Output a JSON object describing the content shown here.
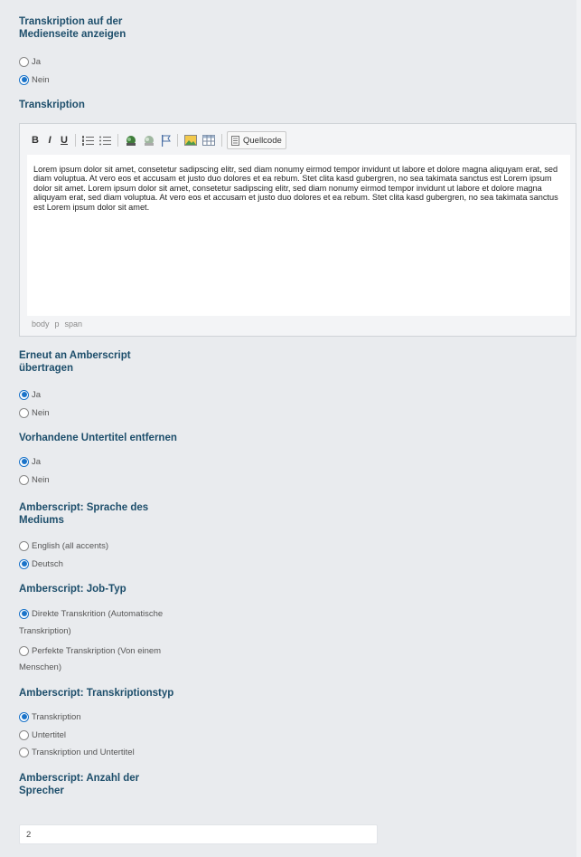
{
  "transcription_show": {
    "title_line1": "Transkription auf der",
    "title_line2": "Medienseite anzeigen",
    "options": [
      "Ja",
      "Nein"
    ],
    "selected": "Nein"
  },
  "transcription": {
    "title": "Transkription",
    "toolbar": {
      "bold_label": "B",
      "italic_label": "I",
      "underline_label": "U",
      "source_label": "Quellcode"
    },
    "content_text": "Lorem ipsum dolor sit amet, consetetur sadipscing elitr, sed diam nonumy eirmod tempor invidunt ut labore et dolore magna aliquyam erat, sed diam voluptua. At vero eos et accusam et justo duo dolores et ea rebum. Stet clita kasd gubergren, no sea takimata sanctus est Lorem ipsum dolor sit amet. Lorem ipsum dolor sit amet, consetetur sadipscing elitr, sed diam nonumy eirmod tempor invidunt ut labore et dolore magna aliquyam erat, sed diam voluptua. At vero eos et accusam et justo duo dolores et ea rebum. Stet clita kasd gubergren, no sea takimata sanctus est Lorem ipsum dolor sit amet.",
    "path": [
      "body",
      "p",
      "span"
    ]
  },
  "resend": {
    "title_line1": "Erneut an Amberscript",
    "title_line2": "übertragen",
    "options": [
      "Ja",
      "Nein"
    ],
    "selected": "Ja"
  },
  "remove_subtitles": {
    "title": "Vorhandene Untertitel entfernen",
    "options": [
      "Ja",
      "Nein"
    ],
    "selected": "Ja"
  },
  "language": {
    "title_line1": "Amberscript: Sprache des",
    "title_line2": "Mediums",
    "options": [
      "English (all accents)",
      "Deutsch"
    ],
    "selected": "Deutsch"
  },
  "job_type": {
    "title": "Amberscript: Job-Typ",
    "option1_line1": "Direkte Transkrition (Automatische",
    "option1_line2": "Transkription)",
    "option2_line1": "Perfekte Transkription (Von einem",
    "option2_line2": "Menschen)",
    "selected": "Direkte Transkrition"
  },
  "transcription_type": {
    "title": "Amberscript: Transkriptionstyp",
    "options": [
      "Transkription",
      "Untertitel",
      "Transkription und Untertitel"
    ],
    "selected": "Transkription"
  },
  "speakers": {
    "title_line1": "Amberscript: Anzahl der",
    "title_line2": "Sprecher",
    "value": "2"
  }
}
